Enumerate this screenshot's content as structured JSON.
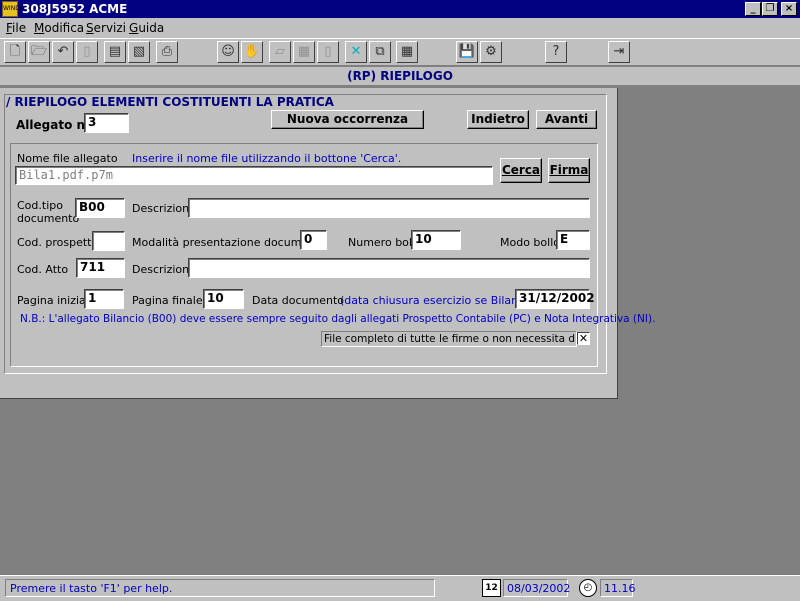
{
  "window": {
    "title": "308J5952 ACME",
    "app_icon_text": "WINDOWS"
  },
  "menu": {
    "items": [
      {
        "label": "File",
        "underline": "F"
      },
      {
        "label": "Modifica",
        "underline": "M"
      },
      {
        "label": "Servizi",
        "underline": "S"
      },
      {
        "label": "Guida",
        "underline": "G"
      }
    ]
  },
  "toolbar": {
    "buttons": [
      "new-icon",
      "open-icon",
      "undo-icon",
      "trash-icon",
      "copy-page-icon",
      "paste-page-icon",
      "print-icon",
      "person-icon",
      "hand-icon",
      "folder-icon",
      "stamp-icon",
      "trash2-icon",
      "cross-icon",
      "duplicate-icon",
      "table-icon",
      "save-icon",
      "disk-gear-icon",
      "help-icon",
      "exit-icon"
    ]
  },
  "header": {
    "title": "(RP)  RIEPILOGO"
  },
  "group": {
    "title": "/ RIEPILOGO ELEMENTI COSTITUENTI LA PRATICA"
  },
  "allegato": {
    "label": "Allegato n.",
    "value": "3"
  },
  "buttons": {
    "nuova": "Nuova occorrenza",
    "indietro": "Indietro",
    "avanti": "Avanti",
    "cerca": "Cerca",
    "firma": "Firma"
  },
  "file": {
    "label": "Nome file allegato",
    "hint": "Inserire il nome file utilizzando il bottone 'Cerca'.",
    "value": "Bila1.pdf.p7m"
  },
  "codtipo": {
    "label1": "Cod.tipo",
    "label2": "documento",
    "value": "B00",
    "desc_label": "Descrizione",
    "desc_value": ""
  },
  "prospetto": {
    "label": "Cod. prospetto",
    "value": "",
    "modalita_label": "Modalità presentazione documento",
    "modalita_value": "0",
    "bolli_label": "Numero bolli",
    "bolli_value": "10",
    "modo_label": "Modo bollo",
    "modo_value": "E"
  },
  "atto": {
    "label": "Cod. Atto",
    "value": "711",
    "desc_label": "Descrizione",
    "desc_value": ""
  },
  "pagine": {
    "iniziale_label": "Pagina iniziale",
    "iniziale_value": "1",
    "finale_label": "Pagina finale",
    "finale_value": "10",
    "data_label": "Data documento",
    "data_hint": "(data chiusura esercizio se Bilancio)",
    "data_value": "31/12/2002"
  },
  "nota": "N.B.: L'allegato Bilancio (B00) deve essere sempre seguito dagli allegati Prospetto Contabile (PC) e Nota Integrativa (NI).",
  "completo": {
    "label": "File completo di tutte le firme o non necessita di firme.",
    "checked": "✕"
  },
  "status": {
    "help": "Premere il tasto 'F1' per help.",
    "date": "08/03/2002",
    "time": "11.16"
  }
}
